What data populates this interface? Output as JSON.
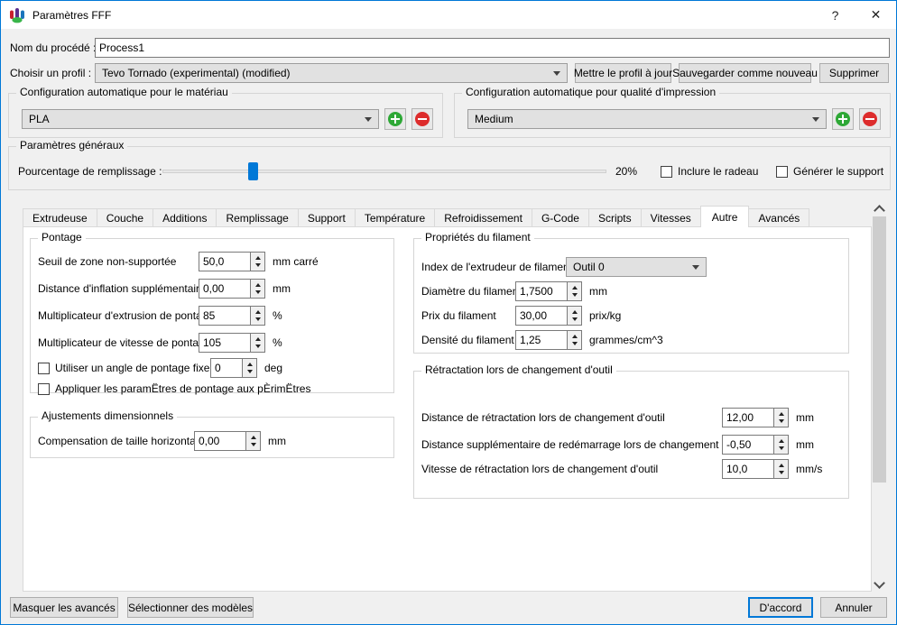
{
  "window": {
    "title": "Paramètres FFF",
    "help": "?",
    "close": "✕"
  },
  "colors": {
    "accent": "#0078d7",
    "add_green": "#2ea836",
    "remove_red": "#dd2c2c",
    "slider_handle": "#0078d7"
  },
  "header": {
    "process_name_label": "Nom du procédé :",
    "process_name_value": "Process1",
    "profile_label": "Choisir un profil :",
    "profile_value": "Tevo Tornado (experimental) (modified)",
    "update_profile": "Mettre le profil à jour",
    "save_as_new": "Sauvegarder comme nouveau",
    "delete": "Supprimer"
  },
  "material": {
    "title": "Configuration automatique pour le matériau",
    "value": "PLA"
  },
  "quality": {
    "title": "Configuration automatique pour qualité d'impression",
    "value": "Medium"
  },
  "general": {
    "title": "Paramètres généraux",
    "infill_label": "Pourcentage de remplissage :",
    "infill_value": "20%",
    "infill_percent": 20,
    "raft_label": "Inclure le radeau",
    "raft_checked": false,
    "support_label": "Générer le support",
    "support_checked": false
  },
  "tabs": [
    "Extrudeuse",
    "Couche",
    "Additions",
    "Remplissage",
    "Support",
    "Température",
    "Refroidissement",
    "G-Code",
    "Scripts",
    "Vitesses",
    "Autre",
    "Avancés"
  ],
  "active_tab": "Autre",
  "pontage": {
    "title": "Pontage",
    "rows": [
      {
        "label": "Seuil de zone non-supportée",
        "value": "50,0",
        "unit": "mm carré"
      },
      {
        "label": "Distance d'inflation supplémentaire",
        "value": "0,00",
        "unit": "mm"
      },
      {
        "label": "Multiplicateur d'extrusion de pontage",
        "value": "85",
        "unit": "%"
      },
      {
        "label": "Multiplicateur de vitesse de pontage",
        "value": "105",
        "unit": "%"
      }
    ],
    "fixed_angle": {
      "label": "Utiliser un angle de pontage fixe.",
      "value": "0",
      "unit": "deg",
      "checked": false
    },
    "apply_perimeters": {
      "label": "Appliquer les paramËtres de pontage aux pÈrimËtres",
      "checked": false
    }
  },
  "dimensional": {
    "title": "Ajustements dimensionnels",
    "row": {
      "label": "Compensation de taille horizontale",
      "value": "0,00",
      "unit": "mm"
    }
  },
  "filament": {
    "title": "Propriétés du filament",
    "extruder": {
      "label": "Index de l'extrudeur de filament",
      "value": "Outil 0"
    },
    "rows": [
      {
        "label": "Diamètre du filament",
        "value": "1,7500",
        "unit": "mm"
      },
      {
        "label": "Prix du filament",
        "value": "30,00",
        "unit": "prix/kg"
      },
      {
        "label": "Densité du filament",
        "value": "1,25",
        "unit": "grammes/cm^3"
      }
    ]
  },
  "toolchange": {
    "title": "Rétractation lors de changement d'outil",
    "rows": [
      {
        "label": "Distance de rétractation lors de changement d'outil",
        "value": "12,00",
        "unit": "mm"
      },
      {
        "label": "Distance supplémentaire de redémarrage lors de changement d'outil",
        "value": "-0,50",
        "unit": "mm"
      },
      {
        "label": "Vitesse de rétractation lors de changement d'outil",
        "value": "10,0",
        "unit": "mm/s"
      }
    ]
  },
  "footer": {
    "hide_advanced": "Masquer les avancés",
    "select_models": "Sélectionner des modèles",
    "ok": "D'accord",
    "cancel": "Annuler"
  }
}
